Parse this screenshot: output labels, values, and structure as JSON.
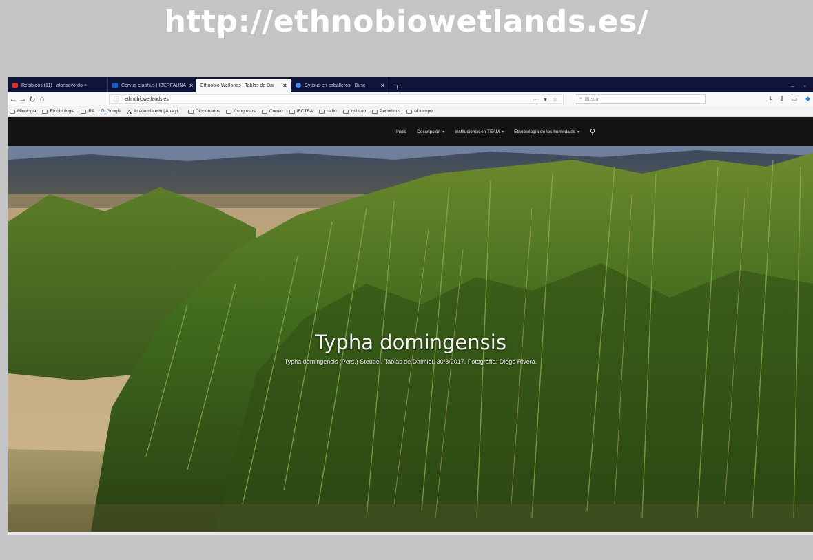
{
  "slide": {
    "title": "http://ethnobiowetlands.es/"
  },
  "browser": {
    "tabs": [
      {
        "label": "Recibidos (11) - alonsovordo ×",
        "favicon_color": "#d93025",
        "active": false
      },
      {
        "label": "Cervus elaphus | IBERFAUNA",
        "favicon_color": "#1a5fd0",
        "active": false
      },
      {
        "label": "Ethnobio Wetlands | Tablas de Dai",
        "favicon_color": "#cccccc",
        "active": true
      },
      {
        "label": "Cytisus en caballeros - Busc",
        "favicon_color": "#4285f4",
        "active": false
      }
    ],
    "new_tab": "+",
    "url": "ethnobiowetlands.es",
    "url_actions": [
      "···",
      "♥",
      "☆"
    ],
    "search_placeholder": "Buscar",
    "toolbar_icons": [
      "downloads-icon",
      "library-icon",
      "sidebar-icon",
      "sync-icon"
    ],
    "bookmarks": [
      {
        "label": "Micologia",
        "type": "folder"
      },
      {
        "label": "Etnobiologia",
        "type": "folder"
      },
      {
        "label": "RA",
        "type": "folder"
      },
      {
        "label": "Google",
        "type": "google"
      },
      {
        "label": "Academia.edu | Analyt...",
        "type": "academia"
      },
      {
        "label": "Diccionarios",
        "type": "folder"
      },
      {
        "label": "Congresos",
        "type": "folder"
      },
      {
        "label": "Correo",
        "type": "folder"
      },
      {
        "label": "IECTBA",
        "type": "folder"
      },
      {
        "label": "radio",
        "type": "folder"
      },
      {
        "label": "instituto",
        "type": "folder"
      },
      {
        "label": "Periodicos",
        "type": "folder"
      },
      {
        "label": "el tiempo",
        "type": "folder"
      }
    ]
  },
  "site": {
    "nav": [
      {
        "label": "Inicio",
        "dropdown": false
      },
      {
        "label": "Descripción",
        "dropdown": true
      },
      {
        "label": "Instituciones en TEAM",
        "dropdown": true
      },
      {
        "label": "Etnobiología de los humedales",
        "dropdown": true
      }
    ],
    "hero": {
      "title": "Typha domingensis",
      "subtitle": "Typha domingensis (Pers.) Steudel. Tablas de Daimiel, 30/8/2017. Fotografía: Diego Rivera."
    }
  },
  "colors": {
    "slide_bg": "#c4c4c4",
    "tabbar_bg": "#0f1538",
    "site_nav_bg": "#141414",
    "sync_icon": "#1c8ce8"
  }
}
